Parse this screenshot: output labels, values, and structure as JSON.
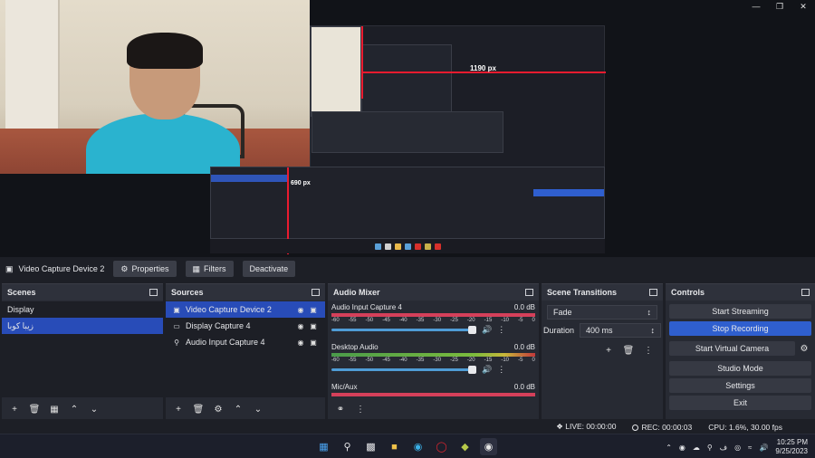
{
  "preview": {
    "overlay_label": "1190 px",
    "overlay_label_small": "690 px"
  },
  "source_toolbar": {
    "source_name": "Video Capture Device 2",
    "properties_label": "Properties",
    "filters_label": "Filters",
    "deactivate_label": "Deactivate"
  },
  "scenes": {
    "title": "Scenes",
    "items": [
      "Display",
      "زیبا کوبا"
    ],
    "selected_index": 1
  },
  "sources": {
    "title": "Sources",
    "items": [
      {
        "label": "Video Capture Device 2",
        "icon": "camera-icon"
      },
      {
        "label": "Display Capture 4",
        "icon": "monitor-icon"
      },
      {
        "label": "Audio Input Capture 4",
        "icon": "microphone-icon"
      }
    ]
  },
  "mixer": {
    "title": "Audio Mixer",
    "channels": [
      {
        "name": "Audio Input Capture 4",
        "db": "0.0 dB",
        "level": 0.92
      },
      {
        "name": "Desktop Audio",
        "db": "0.0 dB",
        "level": 0.92
      },
      {
        "name": "Mic/Aux",
        "db": "0.0 dB",
        "level": 1.0
      }
    ],
    "scale": [
      "-60",
      "-55",
      "-50",
      "-45",
      "-40",
      "-35",
      "-30",
      "-25",
      "-20",
      "-15",
      "-10",
      "-5",
      "0"
    ]
  },
  "transitions": {
    "title": "Scene Transitions",
    "selected": "Fade",
    "duration_label": "Duration",
    "duration_value": "400 ms"
  },
  "controls": {
    "title": "Controls",
    "start_streaming": "Start Streaming",
    "stop_recording": "Stop Recording",
    "start_virtual_camera": "Start Virtual Camera",
    "studio_mode": "Studio Mode",
    "settings": "Settings",
    "exit": "Exit"
  },
  "status": {
    "live": "LIVE: 00:00:00",
    "rec": "REC: 00:00:03",
    "cpu": "CPU: 1.6%, 30.00 fps"
  },
  "taskbar": {
    "time": "10:25 PM",
    "date": "9/25/2023"
  },
  "colors": {
    "accent": "#284cb8",
    "active_button": "#2f5fcf",
    "overlay_red": "#ea1b2f",
    "dock_bg": "#272a33"
  }
}
